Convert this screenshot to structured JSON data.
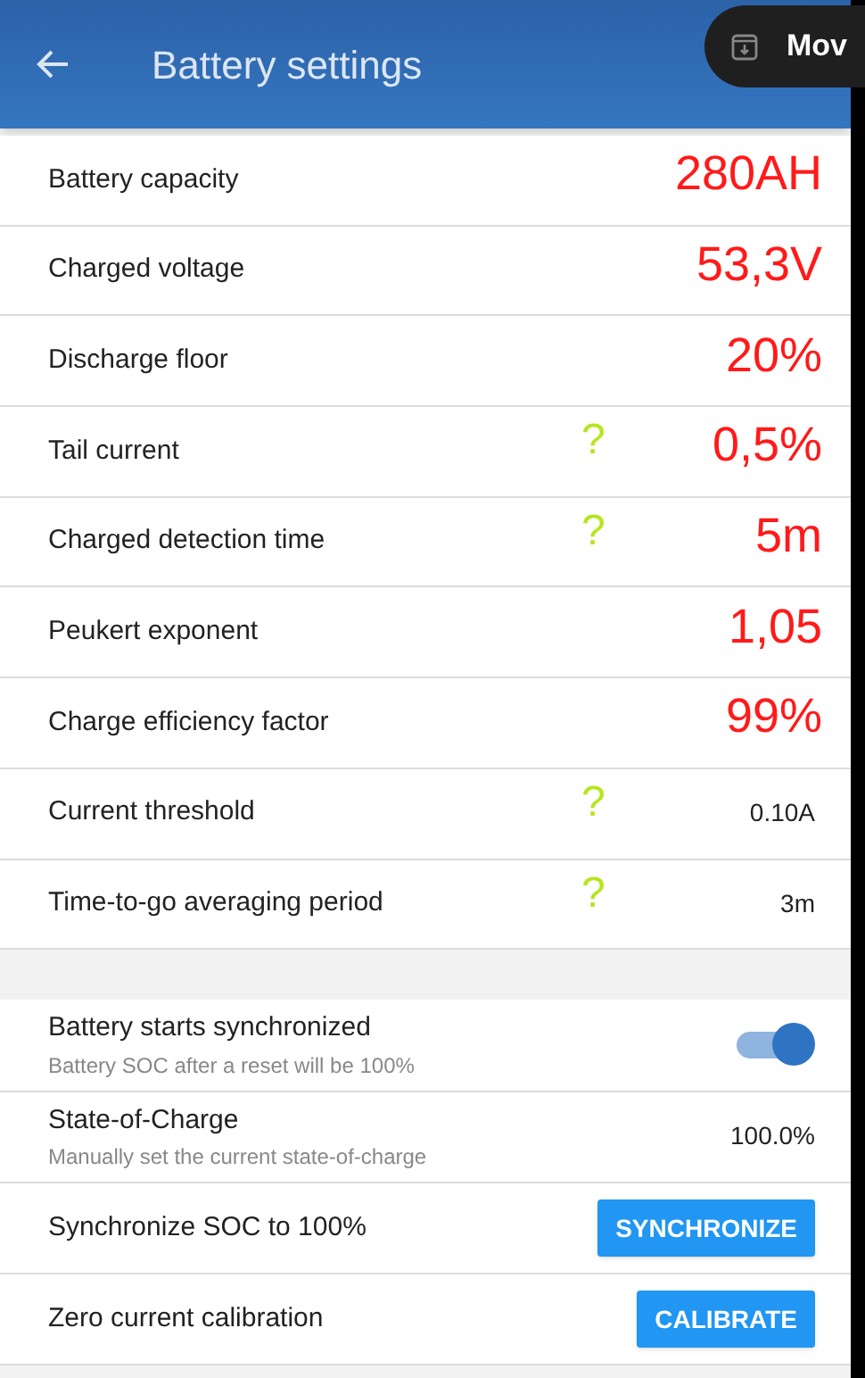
{
  "header": {
    "title": "Battery settings"
  },
  "overlay_pill": {
    "text": "Mov"
  },
  "settings": [
    {
      "label": "Battery capacity",
      "annotation": "280AH",
      "help_mark": false
    },
    {
      "label": "Charged voltage",
      "annotation": "53,3V",
      "help_mark": false
    },
    {
      "label": "Discharge floor",
      "annotation": "20%",
      "help_mark": false
    },
    {
      "label": "Tail current",
      "annotation": "0,5%",
      "help_mark": true
    },
    {
      "label": "Charged detection time",
      "annotation": "5m",
      "help_mark": true
    },
    {
      "label": "Peukert exponent",
      "annotation": "1,05",
      "help_mark": false
    },
    {
      "label": "Charge efficiency factor",
      "annotation": "99%",
      "help_mark": false
    },
    {
      "label": "Current threshold",
      "value": "0.10A",
      "help_mark": true
    },
    {
      "label": "Time-to-go averaging period",
      "value": "3m",
      "help_mark": true
    }
  ],
  "help_mark_text": "?",
  "actions": [
    {
      "kind": "toggle",
      "label": "Battery starts synchronized",
      "subtitle": "Battery SOC after a reset will be 100%",
      "on": true
    },
    {
      "kind": "value",
      "label": "State-of-Charge",
      "subtitle": "Manually set the current state-of-charge",
      "value": "100.0%"
    },
    {
      "kind": "button",
      "label": "Synchronize SOC to 100%",
      "button": "SYNCHRONIZE"
    },
    {
      "kind": "button",
      "label": "Zero current calibration",
      "button": "CALIBRATE"
    }
  ]
}
